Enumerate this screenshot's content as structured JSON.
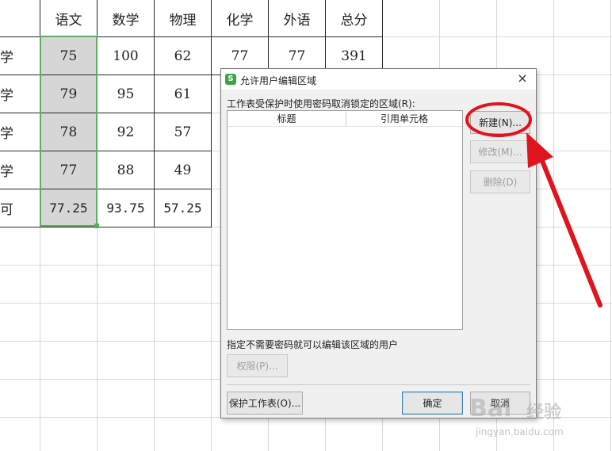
{
  "spreadsheet": {
    "headers": [
      "语文",
      "数学",
      "物理",
      "化学",
      "外语",
      "总分"
    ],
    "rows": [
      {
        "name": "学",
        "values": [
          "75",
          "100",
          "62",
          "77",
          "77",
          "391"
        ]
      },
      {
        "name": "学",
        "values": [
          "79",
          "95",
          "61",
          "",
          "",
          ""
        ]
      },
      {
        "name": "学",
        "values": [
          "78",
          "92",
          "57",
          "",
          "",
          ""
        ]
      },
      {
        "name": "学",
        "values": [
          "77",
          "88",
          "49",
          "",
          "",
          ""
        ]
      },
      {
        "name": "可",
        "values": [
          "77.25",
          "93.75",
          "57.25",
          "",
          "",
          ""
        ]
      }
    ],
    "selection_color": "#5fae5f"
  },
  "dialog": {
    "app_icon": "S",
    "title": "允许用户编辑区域",
    "close_icon": "×",
    "ranges_label": "工作表受保护时使用密码取消锁定的区域(R):",
    "list_columns": [
      "标题",
      "引用单元格"
    ],
    "buttons": {
      "new": "新建(N)...",
      "modify": "修改(M)...",
      "delete": "删除(D)",
      "permissions": "权限(P)...",
      "protect_sheet": "保护工作表(O)...",
      "ok": "确定",
      "cancel": "取消"
    },
    "users_label": "指定不需要密码就可以编辑该区域的用户"
  },
  "annotation": {
    "color": "#e0141e"
  },
  "watermark": {
    "brand1": "Bai",
    "brand2": "经验",
    "url": "jingyan.baidu.com"
  }
}
